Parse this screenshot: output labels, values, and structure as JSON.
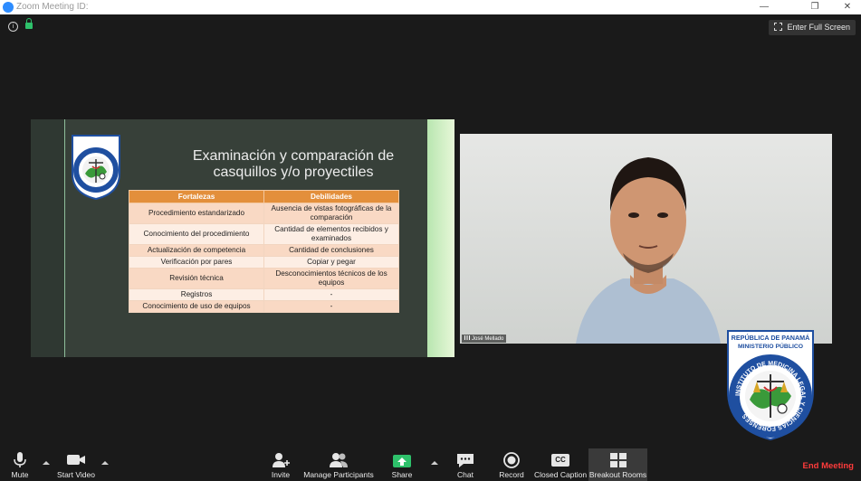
{
  "window": {
    "title": "Zoom Meeting ID:"
  },
  "topbar": {
    "fullscreen_label": "Enter Full Screen"
  },
  "slide": {
    "title_line1": "Examinación y comparación de",
    "title_line2": "casquillos y/o proyectiles",
    "logo_text": "REPÚBLICA DE PANAMÁ MINISTERIO PÚBLICO",
    "table": {
      "headers": [
        "Fortalezas",
        "Debilidades"
      ],
      "rows": [
        [
          "Procedimiento estandarizado",
          "Ausencia de vistas fotográficas de la comparación"
        ],
        [
          "Conocimiento del procedimiento",
          "Cantidad de elementos recibidos y examinados"
        ],
        [
          "Actualización de competencia",
          "Cantidad de conclusiones"
        ],
        [
          "Verificación por pares",
          "Copiar y pegar"
        ],
        [
          "Revisión técnica",
          "Desconocimientos técnicos de los equipos"
        ],
        [
          "Registros",
          "-"
        ],
        [
          "Conocimiento de uso de equipos",
          "-"
        ]
      ]
    }
  },
  "video": {
    "participant_name": "José Mellado"
  },
  "logo": {
    "line1": "REPÚBLICA DE PANAMÁ",
    "line2": "MINISTERIO PÚBLICO",
    "ring_text": "INSTITUTO DE MEDICINA LEGAL Y CIENCIAS FORENSES"
  },
  "toolbar": {
    "mute": "Mute",
    "start_video": "Start Video",
    "invite": "Invite",
    "manage_participants": "Manage Participants",
    "share": "Share",
    "chat": "Chat",
    "record": "Record",
    "closed_caption": "Closed Caption",
    "cc_badge": "CC",
    "breakout_rooms": "Breakout Rooms",
    "end_meeting": "End Meeting"
  },
  "colors": {
    "accent_share": "#2ec16b",
    "end_meeting": "#ff3b3b",
    "table_header": "#e38f3b"
  }
}
